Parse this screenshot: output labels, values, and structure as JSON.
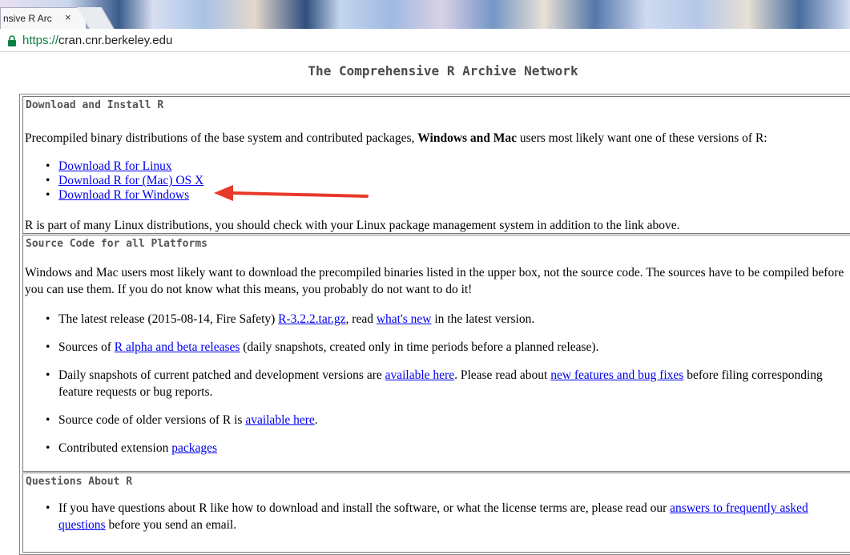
{
  "browser": {
    "tab_title": "nsive R Arc",
    "tab_close": "×",
    "url_scheme": "https://",
    "url_host": "cran.cnr.berkeley.edu"
  },
  "page": {
    "title": "The Comprehensive R Archive Network"
  },
  "download": {
    "heading": "Download and Install R",
    "intro_pre": "Precompiled binary distributions of the base system and contributed packages, ",
    "intro_bold": "Windows and Mac",
    "intro_post": " users most likely want one of these versions of R:",
    "links": [
      "Download R for Linux",
      "Download R for (Mac) OS X",
      "Download R for Windows"
    ],
    "footer": "R is part of many Linux distributions, you should check with your Linux package management system in addition to the link above."
  },
  "source": {
    "heading": "Source Code for all Platforms",
    "intro": "Windows and Mac users most likely want to download the precompiled binaries listed in the upper box, not the source code. The sources have to be compiled before you can use them. If you do not know what this means, you probably do not want to do it!",
    "item1_a": "The latest release (2015-08-14, Fire Safety) ",
    "item1_link1": "R-3.2.2.tar.gz",
    "item1_b": ", read ",
    "item1_link2": "what's new",
    "item1_c": " in the latest version.",
    "item2_a": "Sources of ",
    "item2_link": "R alpha and beta releases",
    "item2_b": " (daily snapshots, created only in time periods before a planned release).",
    "item3_a": "Daily snapshots of current patched and development versions are ",
    "item3_link1": "available here",
    "item3_b": ". Please read about ",
    "item3_link2": "new features and bug fixes",
    "item3_c": " before filing corresponding feature requests or bug reports.",
    "item4_a": "Source code of older versions of R is ",
    "item4_link": "available here",
    "item4_b": ".",
    "item5_a": "Contributed extension ",
    "item5_link": "packages"
  },
  "questions": {
    "heading": "Questions About R",
    "item_a": "If you have questions about R like how to download and install the software, or what the license terms are, please read our ",
    "item_link": "answers to frequently asked questions",
    "item_b": " before you send an email."
  },
  "colors": {
    "link": "#0000ee",
    "arrow": "#e8392a",
    "url_scheme": "#0b8043"
  }
}
